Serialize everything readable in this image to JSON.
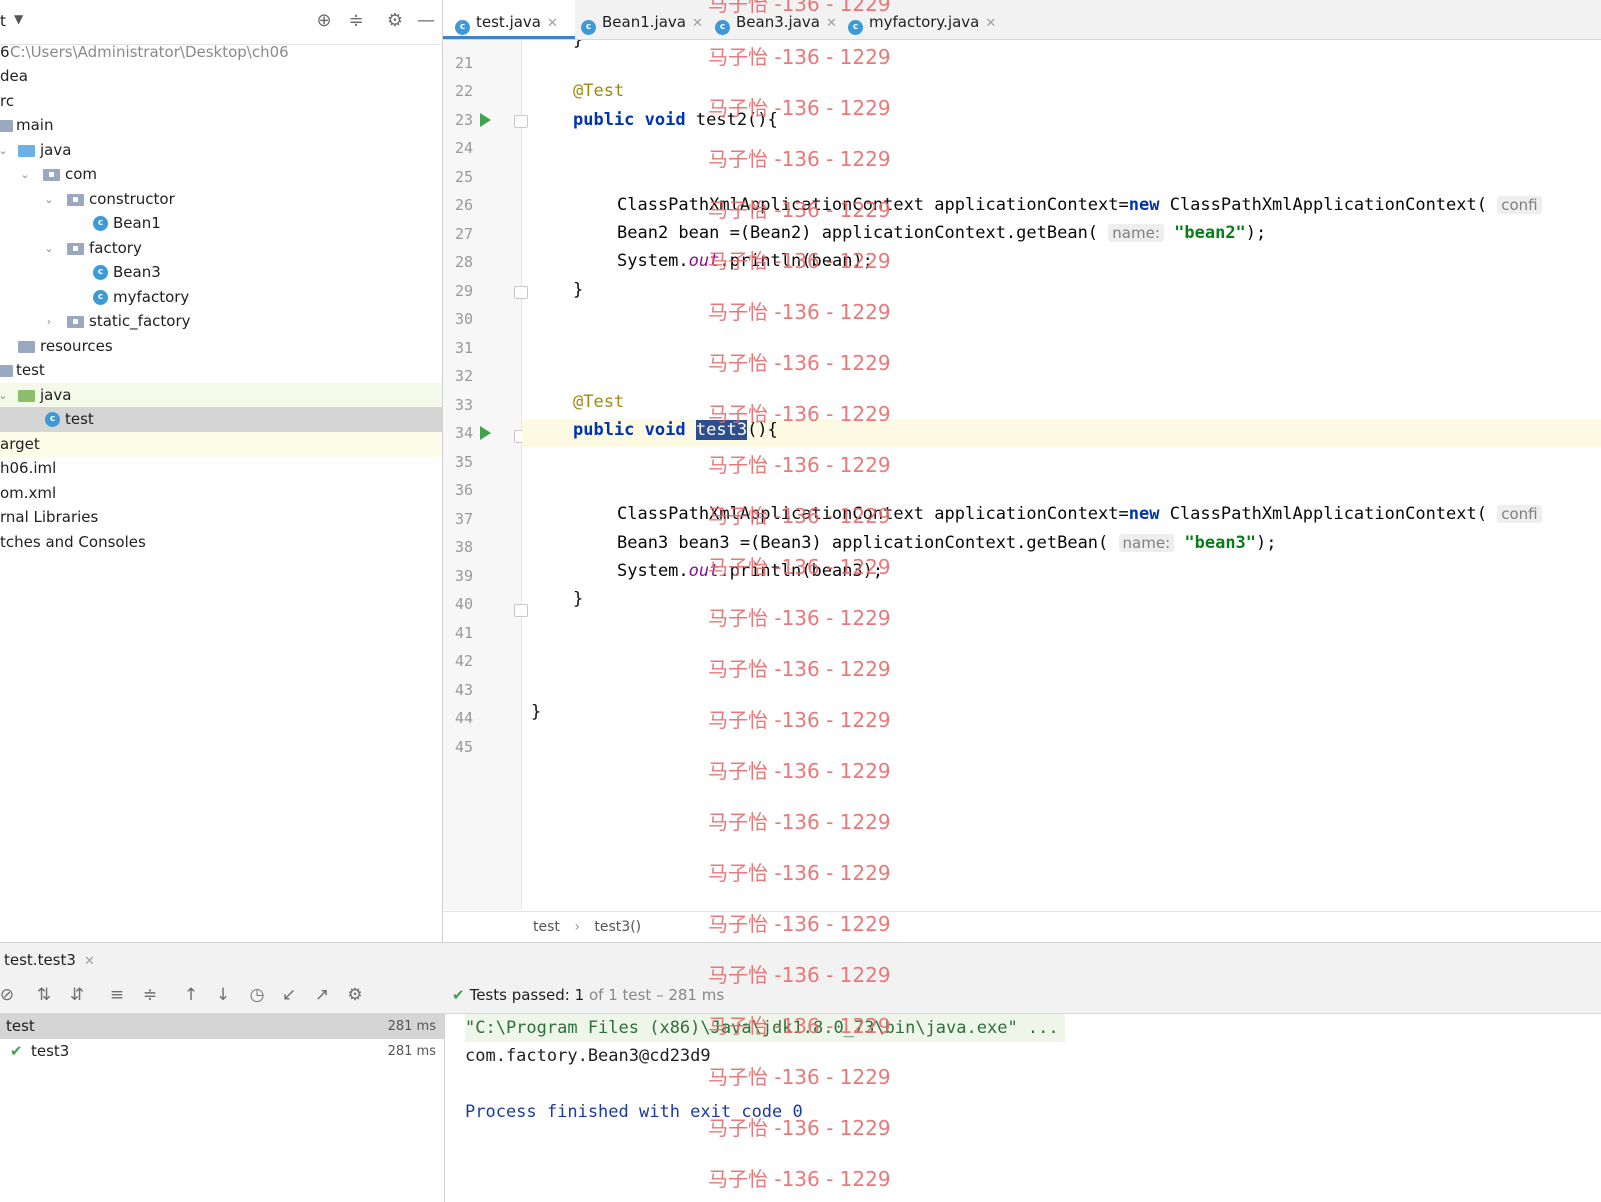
{
  "project_panel": {
    "title": "t",
    "root_name": "6",
    "root_path": "C:\\Users\\Administrator\\Desktop\\ch06",
    "tree": [
      {
        "label": "dea"
      },
      {
        "label": "rc"
      },
      {
        "label": "main"
      },
      {
        "label": "java"
      },
      {
        "label": "com"
      },
      {
        "label": "constructor"
      },
      {
        "label": "Bean1"
      },
      {
        "label": "factory"
      },
      {
        "label": "Bean3"
      },
      {
        "label": "myfactory"
      },
      {
        "label": "static_factory"
      },
      {
        "label": "resources"
      },
      {
        "label": "test"
      },
      {
        "label": "java"
      },
      {
        "label": "test"
      },
      {
        "label": "arget"
      },
      {
        "label": "h06.iml"
      },
      {
        "label": "om.xml"
      },
      {
        "label": "rnal Libraries"
      },
      {
        "label": "tches and Consoles"
      }
    ]
  },
  "editor": {
    "tabs": [
      {
        "label": "test.java",
        "close": "✕"
      },
      {
        "label": "Bean1.java",
        "close": "✕"
      },
      {
        "label": "Bean3.java",
        "close": "✕"
      },
      {
        "label": "myfactory.java",
        "close": "✕"
      }
    ],
    "line_numbers": [
      "21",
      "22",
      "23",
      "24",
      "25",
      "26",
      "27",
      "28",
      "29",
      "30",
      "31",
      "32",
      "33",
      "34",
      "35",
      "36",
      "37",
      "38",
      "39",
      "40",
      "41",
      "42",
      "43",
      "44",
      "45"
    ],
    "code": {
      "prev_close": "}",
      "ann1": "@Test",
      "kw_public": "public",
      "kw_void": "void",
      "m2": "test2(){",
      "l26a": "ClassPathXmlApplicationContext applicationContext=",
      "kw_new": "new",
      "l26b": " ClassPathXmlApplicationContext(",
      "hint_conf": "confi",
      "l27a": "Bean2 bean =(Bean2) applicationContext.getBean(",
      "hint_name": "name:",
      "str_bean2": "\"bean2\"",
      "l_end": ");",
      "sys": "System.",
      "out": "out",
      "l28b": ".println(bean);",
      "close": "}",
      "ann2": "@Test",
      "m3_sel": "test3",
      "m3_rest": "(){",
      "l38a": "Bean3 bean3 =(Bean3) applicationContext.getBean(",
      "str_bean3": "\"bean3\"",
      "l39b": ".println(bean3);",
      "class_close": "}"
    },
    "breadcrumb": {
      "class": "test",
      "sep": "›",
      "method": "test3()"
    }
  },
  "run_window": {
    "tab_label": "test.test3",
    "tab_close": "✕",
    "tests_passed": {
      "prefix": "Tests passed:",
      "count": "1",
      "rest": "of 1 test – 281 ms"
    },
    "results": [
      {
        "name": "test",
        "time": "281 ms"
      },
      {
        "name": "test3",
        "time": "281 ms"
      }
    ],
    "console": [
      "\"C:\\Program Files (x86)\\Java\\jdk1.8.0_73\\bin\\java.exe\" ...",
      "com.factory.Bean3@cd23d9",
      "Process finished with exit code 0"
    ]
  },
  "watermark": "马子怡 -136 - 1229"
}
